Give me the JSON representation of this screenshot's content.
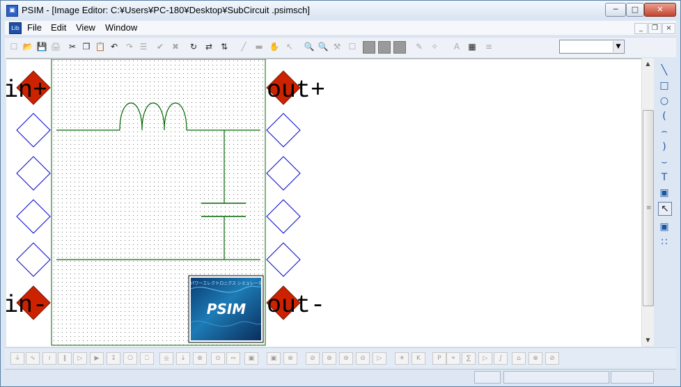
{
  "window": {
    "title": "PSIM - [Image Editor: C:¥Users¥PC-180¥Desktop¥SubCircuit .psimsch]",
    "app_icon": "psim-app-icon",
    "controls": {
      "minimize": "─",
      "maximize": "□",
      "close": "✕"
    }
  },
  "menubar": {
    "doc_icon": "Lib",
    "items": [
      {
        "label": "File"
      },
      {
        "label": "Edit"
      },
      {
        "label": "View"
      },
      {
        "label": "Window"
      }
    ],
    "mdi_controls": {
      "minimize": "_",
      "restore": "❐",
      "close": "×"
    }
  },
  "toolbar": {
    "tools": [
      {
        "name": "new-icon",
        "glyph": "☐",
        "state": "disabled"
      },
      {
        "name": "open-icon",
        "glyph": "📂",
        "state": "disabled"
      },
      {
        "name": "save-icon",
        "glyph": "💾",
        "state": "disabled"
      },
      {
        "name": "print-icon",
        "glyph": "🖨",
        "state": "disabled"
      },
      {
        "name": "cut-icon",
        "glyph": "✂",
        "state": "enabled"
      },
      {
        "name": "copy-icon",
        "glyph": "❐",
        "state": "enabled"
      },
      {
        "name": "paste-icon",
        "glyph": "📋",
        "state": "enabled"
      },
      {
        "name": "undo-icon",
        "glyph": "↶",
        "state": "enabled"
      },
      {
        "name": "redo-icon",
        "glyph": "↷",
        "state": "disabled"
      },
      {
        "name": "clipboard-icon",
        "glyph": "☰",
        "state": "disabled"
      },
      {
        "name": "check-icon",
        "glyph": "✔",
        "state": "disabled"
      },
      {
        "name": "delete-icon",
        "glyph": "✖",
        "state": "disabled"
      },
      {
        "name": "rotate-icon",
        "glyph": "↻",
        "state": "enabled"
      },
      {
        "name": "flip-horizontal-icon",
        "glyph": "⇄",
        "state": "enabled"
      },
      {
        "name": "flip-vertical-icon",
        "glyph": "⇅",
        "state": "enabled"
      },
      {
        "name": "wire-icon",
        "glyph": "╱",
        "state": "disabled"
      },
      {
        "name": "label-icon",
        "glyph": "▬",
        "state": "disabled"
      },
      {
        "name": "pan-hand-icon",
        "glyph": "✋",
        "state": "disabled"
      },
      {
        "name": "select-arrow-icon",
        "glyph": "↖",
        "state": "disabled"
      },
      {
        "name": "zoom-in-icon",
        "glyph": "🔍",
        "state": "enabled"
      },
      {
        "name": "zoom-out-icon",
        "glyph": "🔍",
        "state": "enabled"
      },
      {
        "name": "probe-icon",
        "glyph": "⚒",
        "state": "disabled"
      },
      {
        "name": "page-icon",
        "glyph": "☐",
        "state": "disabled"
      },
      {
        "name": "run-icon",
        "glyph": "",
        "state": "solid"
      },
      {
        "name": "pause-icon",
        "glyph": "",
        "state": "solid"
      },
      {
        "name": "stop-icon",
        "glyph": "",
        "state": "solid"
      },
      {
        "name": "pen-icon",
        "glyph": "✎",
        "state": "disabled"
      },
      {
        "name": "wand-icon",
        "glyph": "✧",
        "state": "disabled"
      },
      {
        "name": "text-icon",
        "glyph": "A",
        "state": "disabled"
      },
      {
        "name": "color-palette-icon",
        "glyph": "▦",
        "state": "enabled"
      },
      {
        "name": "properties-icon",
        "glyph": "≡",
        "state": "disabled"
      }
    ],
    "combo_value": ""
  },
  "canvas": {
    "ports": [
      {
        "side": "left",
        "label": "in+",
        "filled": true
      },
      {
        "side": "left",
        "label": "",
        "filled": false
      },
      {
        "side": "left",
        "label": "",
        "filled": false
      },
      {
        "side": "left",
        "label": "",
        "filled": false
      },
      {
        "side": "left",
        "label": "",
        "filled": false
      },
      {
        "side": "left",
        "label": "in-",
        "filled": true
      },
      {
        "side": "right",
        "label": "out+",
        "filled": true
      },
      {
        "side": "right",
        "label": "",
        "filled": false
      },
      {
        "side": "right",
        "label": "",
        "filled": false
      },
      {
        "side": "right",
        "label": "",
        "filled": false
      },
      {
        "side": "right",
        "label": "",
        "filled": false
      },
      {
        "side": "right",
        "label": "out-",
        "filled": true
      }
    ],
    "logo": {
      "text": "PSIM",
      "tagline": "パワーエレクトロニクス シミュレータ"
    },
    "colors": {
      "port_fill": "#cc2200",
      "port_outline": "#0000cc",
      "wire": "#006600",
      "grid_dot": "#707070"
    }
  },
  "draw_tools": [
    {
      "name": "line-tool-icon",
      "glyph": "╲"
    },
    {
      "name": "rectangle-tool-icon",
      "glyph": "□"
    },
    {
      "name": "ellipse-tool-icon",
      "glyph": "○"
    },
    {
      "name": "arc-left-tool-icon",
      "glyph": "("
    },
    {
      "name": "arc-top-tool-icon",
      "glyph": "⌢"
    },
    {
      "name": "arc-right-tool-icon",
      "glyph": ")"
    },
    {
      "name": "arc-bottom-tool-icon",
      "glyph": "⌣"
    },
    {
      "name": "text-tool-icon",
      "glyph": "T"
    },
    {
      "name": "image-tool-icon",
      "glyph": "▣"
    },
    {
      "name": "select-tool-icon",
      "glyph": "↖"
    },
    {
      "name": "record-tool-icon",
      "glyph": "▣"
    },
    {
      "name": "grid-tool-icon",
      "glyph": "∷"
    }
  ],
  "element_toolbar": {
    "tools": [
      {
        "name": "ground-icon",
        "glyph": "⏚"
      },
      {
        "name": "resistor-icon",
        "glyph": "∿"
      },
      {
        "name": "inductor-icon",
        "glyph": "≀"
      },
      {
        "name": "capacitor-icon",
        "glyph": "‖"
      },
      {
        "name": "diode-icon",
        "glyph": "▷"
      },
      {
        "name": "zener-icon",
        "glyph": "▶"
      },
      {
        "name": "thyristor-icon",
        "glyph": "↧"
      },
      {
        "name": "switch-icon",
        "glyph": "⎔"
      },
      {
        "name": "transistor-icon",
        "glyph": "⎕"
      },
      {
        "name": "transformer-icon",
        "glyph": "⎒"
      },
      {
        "name": "sensor-icon",
        "glyph": "↓"
      },
      {
        "name": "voltage-probe-icon",
        "glyph": "⊕"
      },
      {
        "name": "current-source-icon",
        "glyph": "⊙"
      },
      {
        "name": "ac-source-icon",
        "glyph": "∾"
      },
      {
        "name": "display-icon",
        "glyph": "▣"
      },
      {
        "name": "scope-icon",
        "glyph": "▣"
      },
      {
        "name": "motor-icon",
        "glyph": "⊗"
      },
      {
        "name": "generator-icon",
        "glyph": "⊘"
      },
      {
        "name": "load-icon",
        "glyph": "⊛"
      },
      {
        "name": "meter-icon",
        "glyph": "⊜"
      },
      {
        "name": "gauge-icon",
        "glyph": "⊝"
      },
      {
        "name": "buffer-icon",
        "glyph": "▷"
      },
      {
        "name": "lamp-icon",
        "glyph": "☀"
      },
      {
        "name": "k-block-icon",
        "glyph": "K"
      },
      {
        "name": "pi-block-icon",
        "glyph": "P"
      },
      {
        "name": "limiter-icon",
        "glyph": "⌖"
      },
      {
        "name": "sum-icon",
        "glyph": "∑"
      },
      {
        "name": "comparator-icon",
        "glyph": "▷"
      },
      {
        "name": "integrator-icon",
        "glyph": "∫"
      },
      {
        "name": "step-icon",
        "glyph": "⌂"
      },
      {
        "name": "multiplier-icon",
        "glyph": "⊗"
      },
      {
        "name": "divider-icon",
        "glyph": "⊘"
      }
    ]
  },
  "scrollbar": {
    "up": "▲",
    "down": "▼",
    "grip": "≡"
  }
}
